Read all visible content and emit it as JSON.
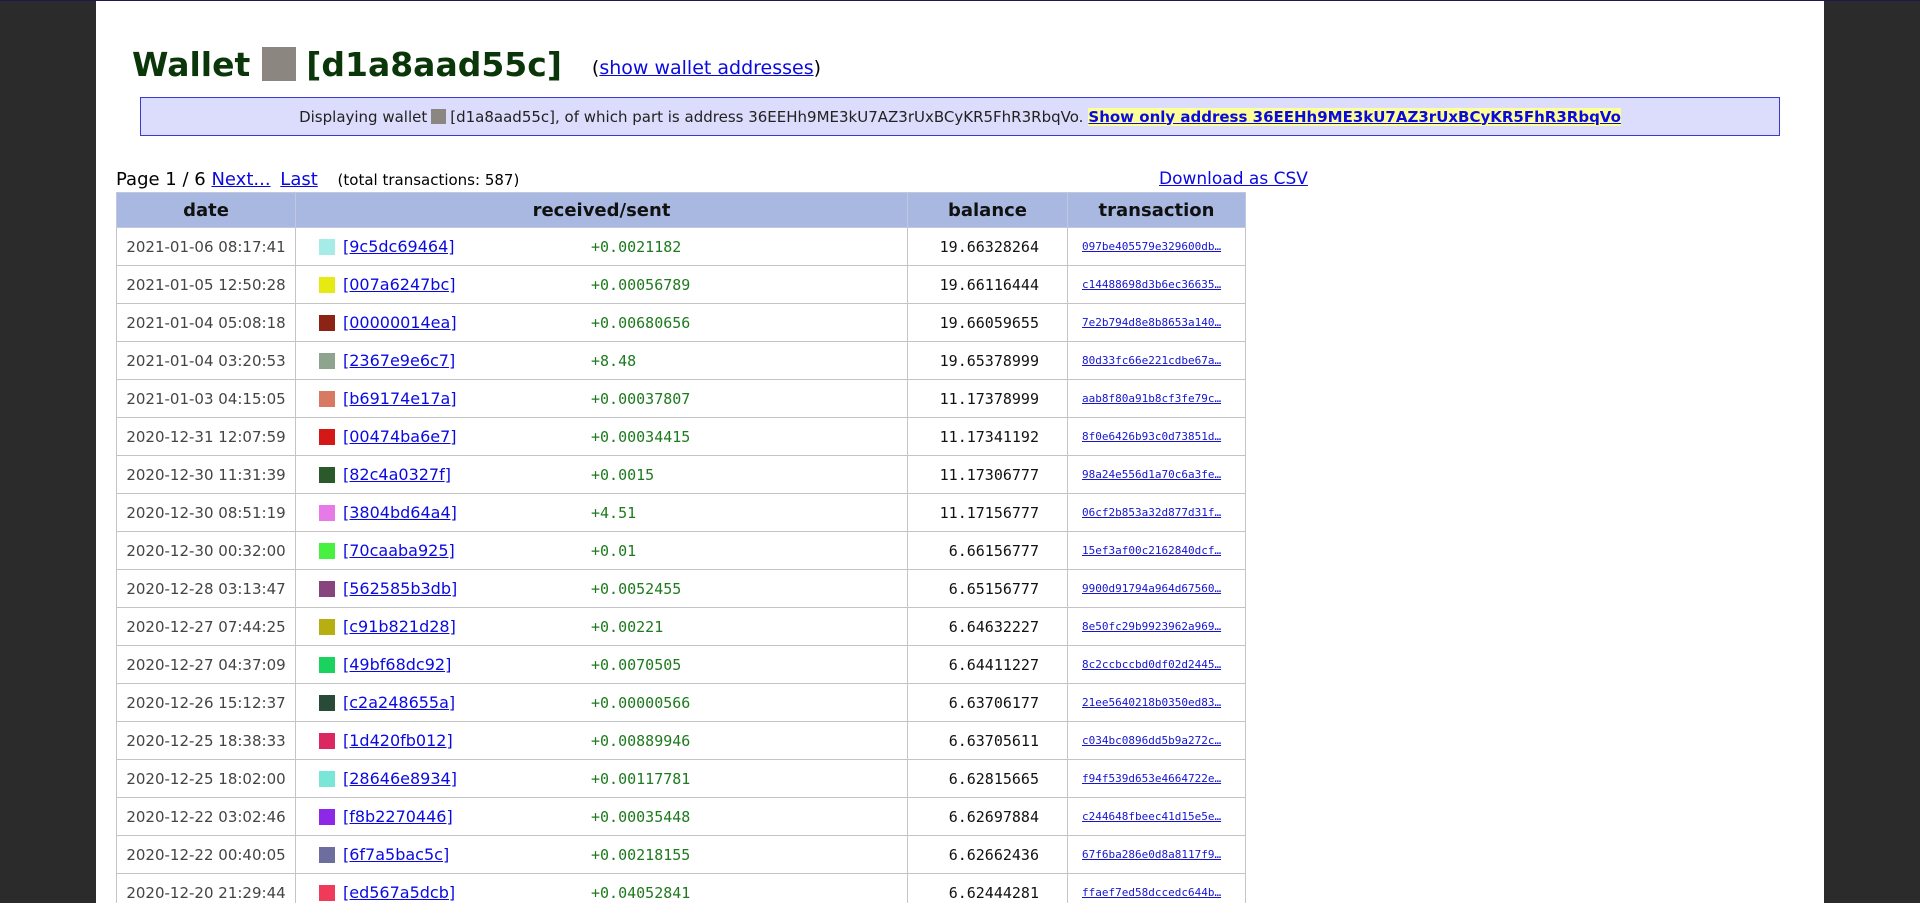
{
  "title": {
    "prefix": "Wallet",
    "wallet_id": "[d1a8aad55c]",
    "swatch_color": "#8c8680",
    "show_addresses_open": "(",
    "show_addresses_link": "show wallet addresses",
    "show_addresses_close": ")"
  },
  "info": {
    "text_before": "Displaying wallet",
    "text_after": "[d1a8aad55c], of which part is address 36EEHh9ME3kU7AZ3rUxBCyKR5FhR3RbqVo.",
    "only_link": "Show only address 36EEHh9ME3kU7AZ3rUxBCyKR5FhR3RbqVo"
  },
  "pager": {
    "page_text": "Page 1 / 6",
    "next": "Next...",
    "last": "Last",
    "total": "(total transactions: 587)"
  },
  "csv_link": "Download as CSV",
  "columns": {
    "date": "date",
    "received_sent": "received/sent",
    "balance": "balance",
    "transaction": "transaction"
  },
  "rows": [
    {
      "date": "2021-01-06 08:17:41",
      "color": "#a6ece6",
      "wallet": "[9c5dc69464]",
      "amount": "+0.0021182",
      "balance": "19.66328264",
      "tx": "097be405579e329600db…"
    },
    {
      "date": "2021-01-05 12:50:28",
      "color": "#e6ea12",
      "wallet": "[007a6247bc]",
      "amount": "+0.00056789",
      "balance": "19.66116444",
      "tx": "c14488698d3b6ec36635…"
    },
    {
      "date": "2021-01-04 05:08:18",
      "color": "#8c2416",
      "wallet": "[00000014ea]",
      "amount": "+0.00680656",
      "balance": "19.66059655",
      "tx": "7e2b794d8e8b8653a140…"
    },
    {
      "date": "2021-01-04 03:20:53",
      "color": "#8ea48e",
      "wallet": "[2367e9e6c7]",
      "amount": "+8.48",
      "balance": "19.65378999",
      "tx": "80d33fc66e221cdbe67a…"
    },
    {
      "date": "2021-01-03 04:15:05",
      "color": "#d87a62",
      "wallet": "[b69174e17a]",
      "amount": "+0.00037807",
      "balance": "11.17378999",
      "tx": "aab8f80a91b8cf3fe79c…"
    },
    {
      "date": "2020-12-31 12:07:59",
      "color": "#d41818",
      "wallet": "[00474ba6e7]",
      "amount": "+0.00034415",
      "balance": "11.17341192",
      "tx": "8f0e6426b93c0d73851d…"
    },
    {
      "date": "2020-12-30 11:31:39",
      "color": "#2a5a2a",
      "wallet": "[82c4a0327f]",
      "amount": "+0.0015",
      "balance": "11.17306777",
      "tx": "98a24e556d1a70c6a3fe…"
    },
    {
      "date": "2020-12-30 08:51:19",
      "color": "#e67ae6",
      "wallet": "[3804bd64a4]",
      "amount": "+4.51",
      "balance": "11.17156777",
      "tx": "06cf2b853a32d877d31f…"
    },
    {
      "date": "2020-12-30 00:32:00",
      "color": "#48f040",
      "wallet": "[70caaba925]",
      "amount": "+0.01",
      "balance": "6.66156777",
      "tx": "15ef3af00c2162840dcf…"
    },
    {
      "date": "2020-12-28 03:13:47",
      "color": "#88447e",
      "wallet": "[562585b3db]",
      "amount": "+0.0052455",
      "balance": "6.65156777",
      "tx": "9900d91794a964d67560…"
    },
    {
      "date": "2020-12-27 07:44:25",
      "color": "#b8ae12",
      "wallet": "[c91b821d28]",
      "amount": "+0.00221",
      "balance": "6.64632227",
      "tx": "8e50fc29b9923962a969…"
    },
    {
      "date": "2020-12-27 04:37:09",
      "color": "#1ad25e",
      "wallet": "[49bf68dc92]",
      "amount": "+0.0070505",
      "balance": "6.64411227",
      "tx": "8c2ccbccbd0df02d2445…"
    },
    {
      "date": "2020-12-26 15:12:37",
      "color": "#2a4a38",
      "wallet": "[c2a248655a]",
      "amount": "+0.00000566",
      "balance": "6.63706177",
      "tx": "21ee5640218b0350ed83…"
    },
    {
      "date": "2020-12-25 18:38:33",
      "color": "#dc2860",
      "wallet": "[1d420fb012]",
      "amount": "+0.00889946",
      "balance": "6.63705611",
      "tx": "c034bc0896dd5b9a272c…"
    },
    {
      "date": "2020-12-25 18:02:00",
      "color": "#7ae6d8",
      "wallet": "[28646e8934]",
      "amount": "+0.00117781",
      "balance": "6.62815665",
      "tx": "f94f539d653e4664722e…"
    },
    {
      "date": "2020-12-22 03:02:46",
      "color": "#8c28e6",
      "wallet": "[f8b2270446]",
      "amount": "+0.00035448",
      "balance": "6.62697884",
      "tx": "c244648fbeec41d15e5e…"
    },
    {
      "date": "2020-12-22 00:40:05",
      "color": "#6e6e9e",
      "wallet": "[6f7a5bac5c]",
      "amount": "+0.00218155",
      "balance": "6.62662436",
      "tx": "67f6ba286e0d8a8117f9…"
    },
    {
      "date": "2020-12-20 21:29:44",
      "color": "#f03a5a",
      "wallet": "[ed567a5dcb]",
      "amount": "+0.04052841",
      "balance": "6.62444281",
      "tx": "ffaef7ed58dccedc644b…"
    }
  ]
}
